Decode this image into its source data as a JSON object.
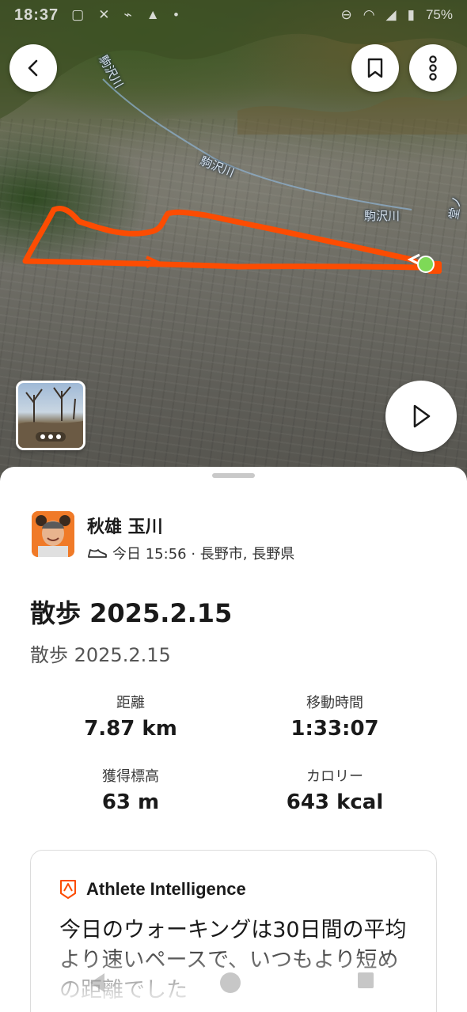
{
  "status_bar": {
    "time": "18:37",
    "battery": "75%"
  },
  "map": {
    "labels": [
      "駒沢川",
      "駒沢川",
      "駒沢川",
      "堂ノ"
    ],
    "route_color": "#fc4c02",
    "start_marker_color": "#7ed957"
  },
  "photo": {
    "count_indicator": "•••"
  },
  "athlete": {
    "name": "秋雄 玉川",
    "meta": "今日 15:56 · 長野市, 長野県"
  },
  "activity": {
    "title": "散歩 2025.2.15",
    "description": "散歩 2025.2.15"
  },
  "stats": [
    {
      "label": "距離",
      "value": "7.87 km"
    },
    {
      "label": "移動時間",
      "value": "1:33:07"
    },
    {
      "label": "獲得標高",
      "value": "63 m"
    },
    {
      "label": "カロリー",
      "value": "643 kcal"
    }
  ],
  "athlete_intelligence": {
    "title": "Athlete Intelligence",
    "text": "今日のウォーキングは30日間の平均より速いペースで、いつもより短めの距離でした"
  },
  "colors": {
    "accent": "#fc4c02"
  }
}
